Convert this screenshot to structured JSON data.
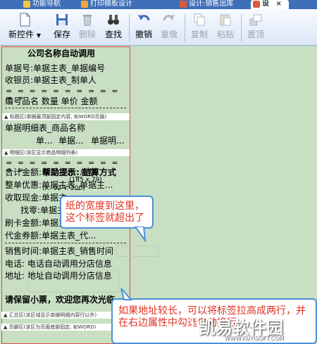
{
  "tabs": [
    {
      "label": "功能导航",
      "color": "#f4c842"
    },
    {
      "label": "打印模板设计",
      "color": "#f2a53a"
    },
    {
      "label": "设计:销售出库",
      "color": "#d95b3b"
    },
    {
      "label": "设",
      "close": "×",
      "color": "#d95b3b"
    }
  ],
  "toolbar": {
    "new_control": "新控件",
    "save": "保存",
    "delete": "删除",
    "find": "查找",
    "undo": "撤销",
    "redo": "重做",
    "copy": "复制",
    "paste": "粘贴",
    "top": "置顶"
  },
  "paper": {
    "title": "公司名称自动调用",
    "rows": [
      "单据号:单据主表_单据编号",
      "收银员:单据主表_制单人",
      "= = = = = = = = = = = =",
      "编号品名  数量    单价       金额"
    ],
    "header_section": "▲ 标题区(单据最顶部固定内容, 如WORD页眉)",
    "detail_field": "单据明细表_商品名称",
    "detail_sub": [
      "单...",
      "单据...",
      "单据明..."
    ],
    "detail_section": "▲ 明细区(该区显示商品明细列表)",
    "eq_line": "= = = = = = = = = = = =",
    "summary_rows": [
      {
        "label": "合计金额:",
        "value": "单据主表_总额"
      },
      {
        "label": "整单优惠:",
        "value": "单据主表_单据主..."
      },
      {
        "label": "收取现金:",
        "value": "单据主..."
      },
      {
        "label": "找零:",
        "value": "单据主..."
      },
      {
        "label": "刷卡金额:",
        "value": "单据主..."
      },
      {
        "label": "代金券额:",
        "value": "单据主表_代..."
      }
    ],
    "sale_time": "销售时间:单据主表_销售时间",
    "phone": "电话: 电话自动调用分店信息",
    "address": "地址: 地址自动调用分店信息",
    "footer": "请保留小票，欢迎您再次光临",
    "summary_section": "▲ 汇总区(该区域显示单据明细内容行以外)",
    "page_footer_section": "▲ 页脚区(该区为页面底部固定, 如WORD)"
  },
  "tooltip": {
    "title": "帮助提示: 结算方式",
    "size": "(185 x 79)",
    "pos": "(X: 92 Y: 200)"
  },
  "callouts": {
    "paper_width": "纸的宽度到这里，这个标签就超出了",
    "address_tip": "如果地址较长，可以将标签拉高成两行，并在右边属性中勾选自动换行"
  },
  "watermark": {
    "k": "K",
    "name": "凯易软件园",
    "url": "WWW.KUYISOFT.COM"
  }
}
